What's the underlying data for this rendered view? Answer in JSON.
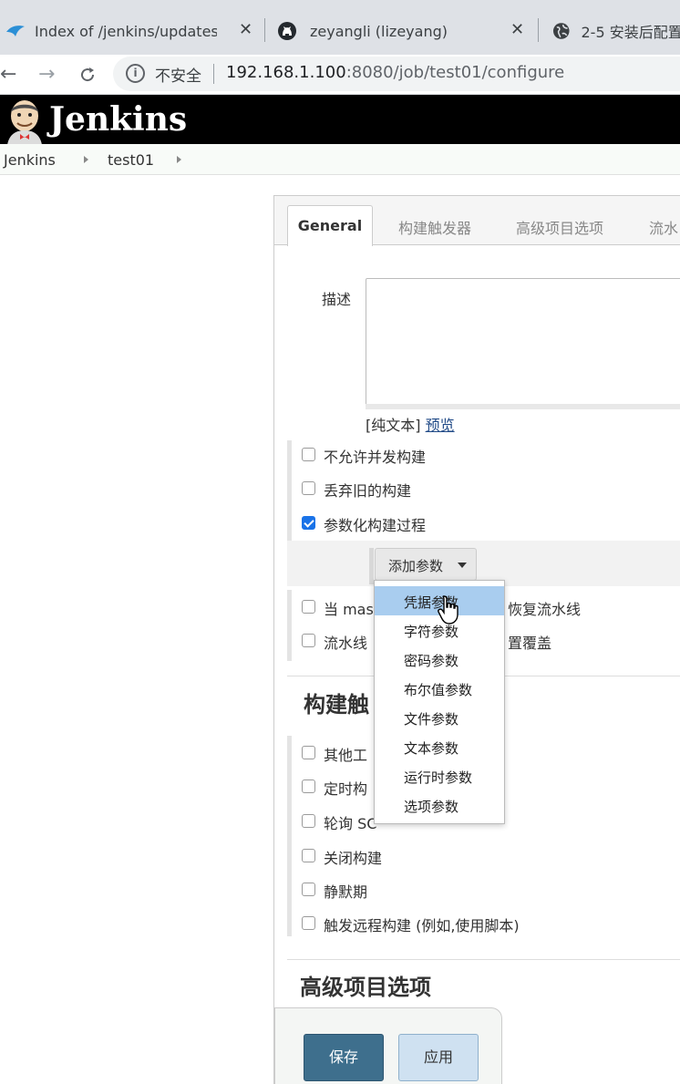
{
  "browser": {
    "tabs": [
      {
        "title": "Index of /jenkins/updates/ | |",
        "icon": "bird-icon"
      },
      {
        "title": "zeyangli (lizeyang)",
        "icon": "github-icon"
      },
      {
        "title": "2-5 安装后配置",
        "icon": "globe-icon"
      }
    ],
    "close_glyph": "✕",
    "nav": {
      "back": "←",
      "forward": "→",
      "reload": "C"
    },
    "omnibox": {
      "info_glyph": "i",
      "security_label": "不安全",
      "url_host": "192.168.1.100",
      "url_rest": ":8080/job/test01/configure"
    }
  },
  "jenkins": {
    "brand": "Jenkins",
    "breadcrumbs": [
      "Jenkins",
      "test01"
    ]
  },
  "config": {
    "tabs": [
      "General",
      "构建触发器",
      "高级项目选项",
      "流水"
    ],
    "description_label": "描述",
    "format_hint": "[纯文本]",
    "preview_link": "预览",
    "general_options": [
      {
        "label": "不允许并发构建",
        "checked": false
      },
      {
        "label": "丢弃旧的构建",
        "checked": false
      },
      {
        "label": "参数化构建过程",
        "checked": true
      }
    ],
    "add_param_button": "添加参数",
    "hidden_options": [
      {
        "label_start": "当 mas",
        "label_end": "恢复流水线",
        "checked": false
      },
      {
        "label_start": "流水线",
        "label_end": "置覆盖",
        "checked": false
      }
    ],
    "triggers_title": "构建触",
    "trigger_options": [
      {
        "label": "其他工",
        "checked": false
      },
      {
        "label": "定时构",
        "checked": false
      },
      {
        "label": "轮询 SC",
        "checked": false
      },
      {
        "label": "关闭构建",
        "checked": false
      },
      {
        "label": "静默期",
        "checked": false
      },
      {
        "label": "触发远程构建 (例如,使用脚本)",
        "checked": false
      }
    ],
    "advanced_title": "高级项目选项",
    "save_button": "保存",
    "apply_button": "应用"
  },
  "param_menu": {
    "items": [
      "凭据参数",
      "字符参数",
      "密码参数",
      "布尔值参数",
      "文件参数",
      "文本参数",
      "运行时参数",
      "选项参数"
    ],
    "hovered_index": 0
  },
  "colors": {
    "header_bg": "#000000",
    "save_button_bg": "#3e6f8d",
    "apply_button_bg": "#cfe1f1",
    "menu_hover_bg": "#a9cdef",
    "checkbox_checked": "#1a73e8"
  }
}
